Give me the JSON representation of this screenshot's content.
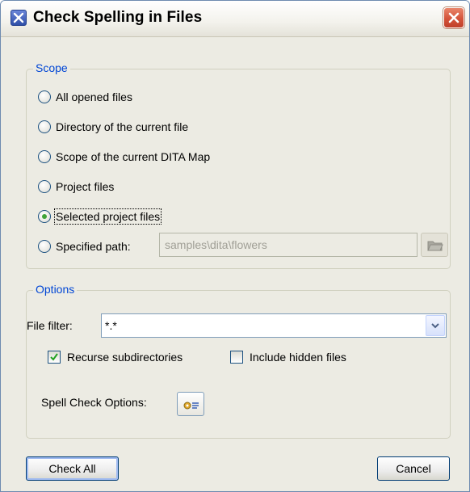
{
  "window": {
    "title": "Check Spelling in Files"
  },
  "scope": {
    "legend": "Scope",
    "options": [
      {
        "label": "All opened files",
        "checked": false
      },
      {
        "label": "Directory of the current file",
        "checked": false
      },
      {
        "label": "Scope of the current DITA Map",
        "checked": false
      },
      {
        "label": "Project files",
        "checked": false
      },
      {
        "label": "Selected project files",
        "checked": true
      },
      {
        "label": "Specified path:",
        "checked": false
      }
    ],
    "specified_path": {
      "value": "samples\\dita\\flowers",
      "enabled": false
    }
  },
  "options": {
    "legend": "Options",
    "file_filter_label": "File filter:",
    "file_filter_value": "*.*",
    "recurse_label": "Recurse subdirectories",
    "recurse_checked": true,
    "hidden_label": "Include hidden files",
    "hidden_checked": false,
    "spell_check_options_label": "Spell Check Options:"
  },
  "buttons": {
    "check_all": "Check All",
    "cancel": "Cancel"
  },
  "colors": {
    "legend": "#0046d5",
    "radio_dot": "#3fa338",
    "close": "#d4533a"
  }
}
